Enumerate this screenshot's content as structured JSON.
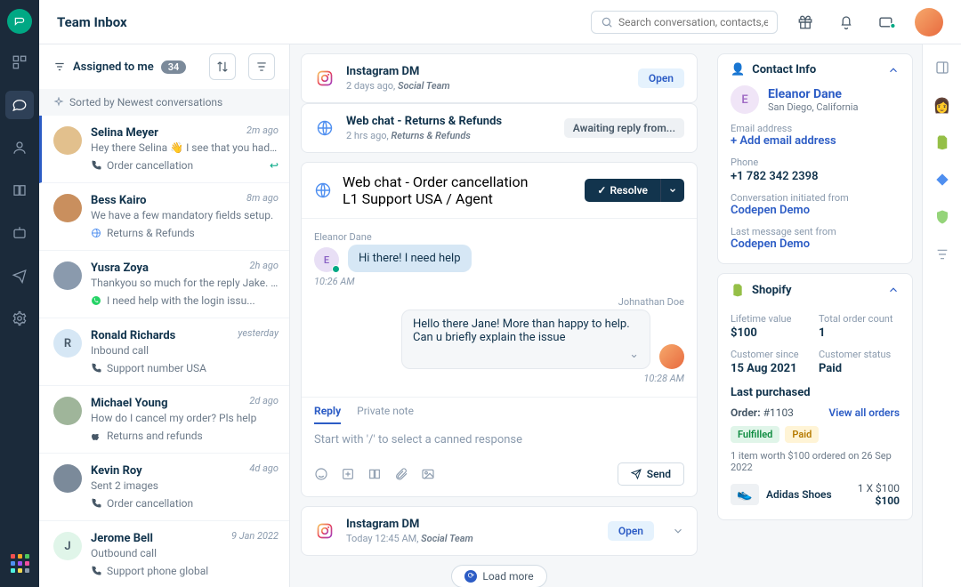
{
  "header": {
    "title": "Team Inbox",
    "search_placeholder": "Search conversation, contacts,etc."
  },
  "conv_filter": {
    "label": "Assigned to me",
    "count": "34",
    "sorted_by": "Sorted by Newest conversations"
  },
  "conversations": [
    {
      "name": "Selina Meyer",
      "time": "2m ago",
      "preview": "Hey there Selina 👋 I see that you had p...",
      "tag": "Order cancellation",
      "tag_icon": "phone",
      "reply": true,
      "initial": "",
      "color": "#e2c08d"
    },
    {
      "name": "Bess Kairo",
      "time": "8m ago",
      "preview": "We have a few mandatory fields setup.",
      "tag": "Returns & Refunds",
      "tag_icon": "globe",
      "initial": "",
      "color": "#c98f5e"
    },
    {
      "name": "Yusra Zoya",
      "time": "2h ago",
      "preview": "Thankyou so much for the reply Jake. Ca...",
      "tag": "I need help with the login issu...",
      "tag_icon": "whatsapp",
      "initial": "",
      "color": "#8a9aad"
    },
    {
      "name": "Ronald Richards",
      "time": "yesterday",
      "preview": "Inbound call",
      "tag": "Support number USA",
      "tag_icon": "phone",
      "initial": "R",
      "color": "#d6e7f5"
    },
    {
      "name": "Michael Young",
      "time": "2d ago",
      "preview": "How do I cancel my order? Pls help",
      "tag": "Returns and refunds",
      "tag_icon": "apple",
      "initial": "",
      "color": "#9fb59a"
    },
    {
      "name": "Kevin Roy",
      "time": "4d ago",
      "preview": "Sent 2 images",
      "tag": "Order cancellation",
      "tag_icon": "phone",
      "initial": "",
      "color": "#7b8a9a"
    },
    {
      "name": "Jerome Bell",
      "time": "9 Jan 2022",
      "preview": "Outbound call",
      "tag": "Support phone global",
      "tag_icon": "phone",
      "initial": "J",
      "color": "#e0f5e9"
    }
  ],
  "threads": [
    {
      "icon": "instagram",
      "title": "Instagram DM",
      "meta_time": "2 days ago,",
      "team": "Social Team",
      "action": "Open"
    },
    {
      "icon": "globe",
      "title": "Web chat - Returns & Refunds",
      "meta_time": "2 hrs ago,",
      "team": "Returns & Refunds",
      "action": "Awaiting reply from..."
    }
  ],
  "active_thread": {
    "icon": "globe",
    "title": "Web chat - Order cancellation",
    "meta": "L1 Support USA",
    "agent": "Agent",
    "resolve": "Resolve",
    "messages": [
      {
        "dir": "in",
        "name": "Eleanor Dane",
        "initial": "E",
        "text": "Hi there! I need help",
        "time": "10:26 AM"
      },
      {
        "dir": "out",
        "name": "Johnathan Doe",
        "text": "Hello there Jane! More than happy to help. Can u briefly explain the issue",
        "time": "10:28 AM"
      }
    ],
    "compose_tabs": {
      "reply": "Reply",
      "note": "Private note"
    },
    "compose_placeholder": "Start with '/' to select a canned response",
    "send": "Send"
  },
  "bottom_thread": {
    "icon": "instagram",
    "title": "Instagram DM",
    "meta_time": "Today 12:45 AM,",
    "team": "Social Team",
    "action": "Open"
  },
  "load_more": "Load more",
  "contact": {
    "header": "Contact Info",
    "initial": "E",
    "name": "Eleanor Dane",
    "location": "San Diego, California",
    "email_label": "Email address",
    "email_action": "+ Add email address",
    "phone_label": "Phone",
    "phone": "+1 782 342 2398",
    "init_label": "Conversation initiated from",
    "init_value": "Codepen Demo",
    "last_label": "Last message sent from",
    "last_value": "Codepen Demo"
  },
  "shopify": {
    "header": "Shopify",
    "fields": [
      {
        "label": "Lifetime value",
        "value": "$100"
      },
      {
        "label": "Total order count",
        "value": "1"
      },
      {
        "label": "Customer since",
        "value": "15 Aug 2021"
      },
      {
        "label": "Customer status",
        "value": "Paid"
      }
    ],
    "last_purchased": "Last purchased",
    "order_label": "Order:",
    "order_id": "#1103",
    "view_all": "View all orders",
    "chips": {
      "fulfilled": "Fulfilled",
      "paid": "Paid"
    },
    "summary": "1 item worth $100 ordered on 26 Sep 2022",
    "product": {
      "name": "Adidas Shoes",
      "qty": "1 X $100",
      "total": "$100"
    }
  }
}
